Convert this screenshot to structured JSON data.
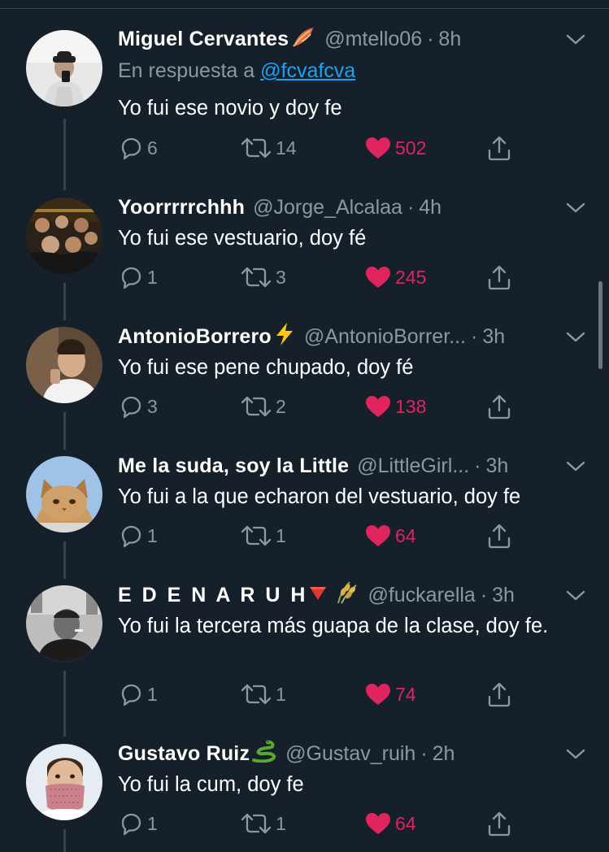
{
  "colors": {
    "background": "#15202b",
    "text": "#ffffff",
    "secondary": "#8899a6",
    "link": "#1da1f2",
    "like": "#e0245e",
    "thread_line": "#38444d"
  },
  "in_reply_to": {
    "prefix": "En respuesta a",
    "user": "@fcvafcva"
  },
  "replies": [
    {
      "name": "Miguel Cervantes",
      "emoji": "feather-emoji",
      "handle": "@mtello06",
      "time": "8h",
      "text": "Yo fui ese novio y doy fe",
      "replies": "6",
      "retweets": "14",
      "likes": "502",
      "liked": true
    },
    {
      "name": "Yoorrrrrchhh",
      "handle": "@Jorge_Alcalaa",
      "time": "4h",
      "text": "Yo fui ese vestuario, doy fé",
      "replies": "1",
      "retweets": "3",
      "likes": "245",
      "liked": true
    },
    {
      "name": "AntonioBorrero",
      "emoji": "lightning-emoji",
      "handle": "@AntonioBorrer...",
      "time": "3h",
      "text": "Yo fui ese pene chupado, doy fé",
      "replies": "3",
      "retweets": "2",
      "likes": "138",
      "liked": true
    },
    {
      "name": "Me la suda, soy la Little",
      "handle": "@LittleGirl...",
      "time": "3h",
      "text": "Yo fui a la que echaron del vestuario, doy fe",
      "replies": "1",
      "retweets": "1",
      "likes": "64",
      "liked": true
    },
    {
      "name": "E D E N A R U H",
      "emoji": "red-triangle-and-rice-emoji",
      "handle": "@fuckarella",
      "time": "3h",
      "text": "Yo fui la tercera más guapa de la clase, doy fe.",
      "replies": "1",
      "retweets": "1",
      "likes": "74",
      "liked": true
    },
    {
      "name": "Gustavo Ruiz",
      "emoji": "snake-emoji",
      "handle": "@Gustav_ruih",
      "time": "2h",
      "text": "Yo fui la cum, doy fe",
      "replies": "1",
      "retweets": "1",
      "likes": "64",
      "liked": true
    }
  ]
}
